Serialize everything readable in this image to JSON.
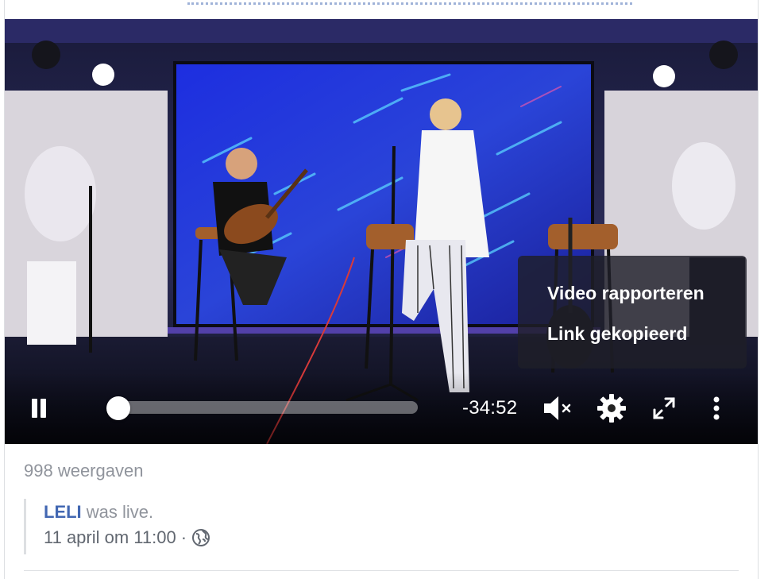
{
  "video": {
    "time_remaining": "-34:52",
    "progress": 0.01,
    "state": "playing",
    "muted": true
  },
  "context_menu": {
    "items": [
      {
        "label": "Video rapporteren"
      },
      {
        "label": "Link gekopieerd"
      }
    ]
  },
  "post": {
    "views": "998 weergaven",
    "shared_author": "LELI",
    "shared_text": " was live.",
    "timestamp": "11 april om 11:00",
    "separator": "·",
    "privacy_icon": "globe-icon"
  },
  "colors": {
    "link": "#4267b2",
    "meta_text": "#90949c",
    "menu_bg": "rgba(30,30,40,.82)"
  }
}
